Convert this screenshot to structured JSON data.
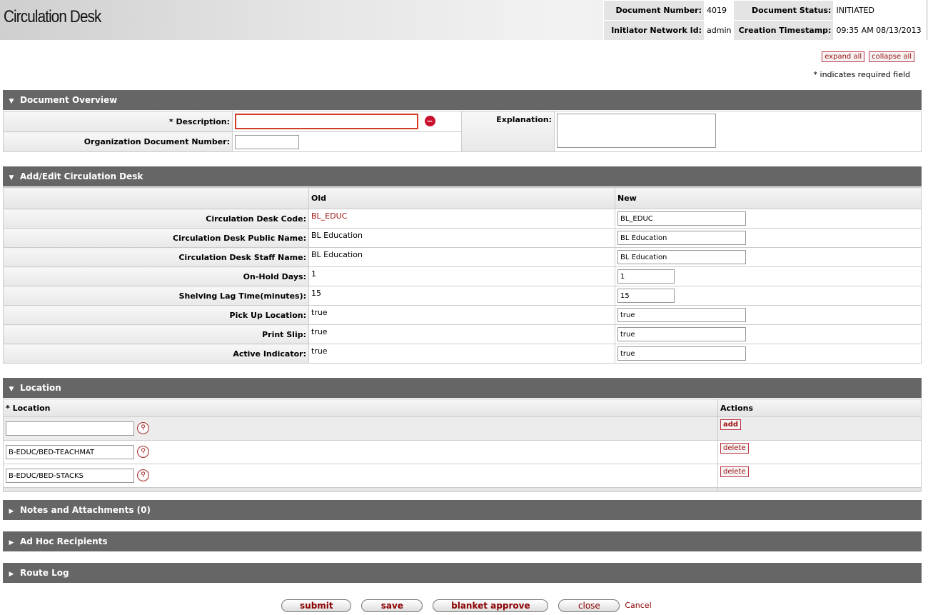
{
  "header": {
    "title": "Circulation Desk",
    "doc_number_label": "Document Number:",
    "doc_number": "4019",
    "doc_status_label": "Document Status:",
    "doc_status": "INITIATED",
    "initiator_label": "Initiator Network Id:",
    "initiator": "admin",
    "created_label": "Creation Timestamp:",
    "created": "09:35 AM 08/13/2013"
  },
  "controls": {
    "expand_all": "expand all",
    "collapse_all": "collapse all",
    "required_note": "* indicates required field"
  },
  "overview": {
    "title": "Document Overview",
    "description_label": "* Description:",
    "description_value": "",
    "org_doc_label": "Organization Document Number:",
    "org_doc_value": "",
    "explanation_label": "Explanation:",
    "explanation_value": "",
    "error_icon": "stop-error-icon"
  },
  "edit": {
    "title": "Add/Edit Circulation Desk",
    "old_header": "Old",
    "new_header": "New",
    "rows": [
      {
        "label": "Circulation Desk Code:",
        "old": "BL_EDUC",
        "new": "BL_EDUC"
      },
      {
        "label": "Circulation Desk Public Name:",
        "old": "BL Education",
        "new": "BL Education"
      },
      {
        "label": "Circulation Desk Staff Name:",
        "old": "BL Education",
        "new": "BL Education"
      },
      {
        "label": "On-Hold Days:",
        "old": "1",
        "new": "1"
      },
      {
        "label": "Shelving Lag Time(minutes):",
        "old": "15",
        "new": "15"
      },
      {
        "label": "Pick Up Location:",
        "old": "true",
        "new": "true"
      },
      {
        "label": "Print Slip:",
        "old": "true",
        "new": "true"
      },
      {
        "label": "Active Indicator:",
        "old": "true",
        "new": "true"
      }
    ]
  },
  "location": {
    "title": "Location",
    "col_location": "* Location",
    "col_actions": "Actions",
    "new_value": "",
    "add_label": "add",
    "items": [
      {
        "value": "B-EDUC/BED-TEACHMAT",
        "action": "delete"
      },
      {
        "value": "B-EDUC/BED-STACKS",
        "action": "delete"
      }
    ]
  },
  "collapsed_sections": {
    "notes": "Notes and Attachments (0)",
    "adhoc": "Ad Hoc Recipients",
    "routelog": "Route Log"
  },
  "actions": {
    "submit": "submit",
    "save": "save",
    "blanket": "blanket approve",
    "close": "close",
    "cancel": "Cancel"
  }
}
